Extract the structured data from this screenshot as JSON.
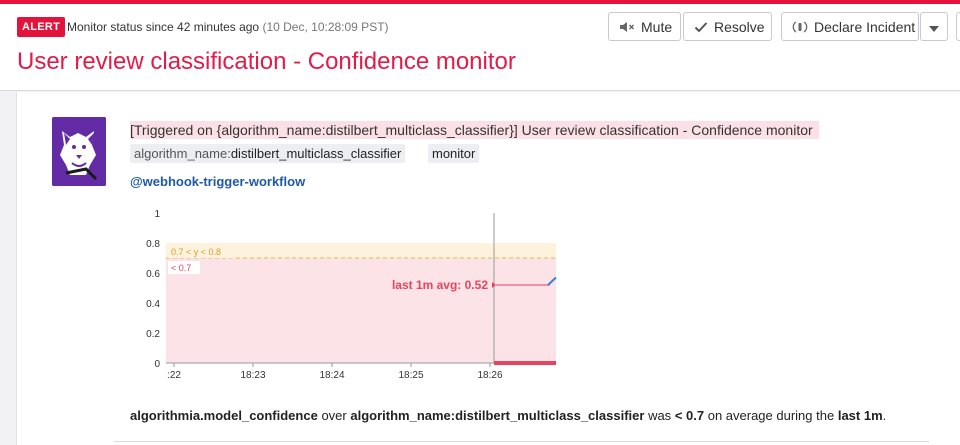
{
  "header": {
    "badge": "ALERT",
    "status_text": "Monitor status since 42 minutes ago",
    "status_timestamp": "(10 Dec, 10:28:09 PST)",
    "title": "User review classification - Confidence monitor"
  },
  "toolbar": {
    "mute_label": "Mute",
    "resolve_label": "Resolve",
    "declare_label": "Declare Incident"
  },
  "icons": [
    "mute-icon",
    "check-icon",
    "incident-icon",
    "caret-down-icon",
    "datadog-avatar-icon"
  ],
  "colors": {
    "alert_red": "#e31b49",
    "critical_zone": "#fbe3e7",
    "warning_zone": "#fdf3dc",
    "mention_blue": "#1f5aa6"
  },
  "event": {
    "message": "[Triggered on {algorithm_name:distilbert_multiclass_classifier}] User review classification - Confidence monitor",
    "tags": [
      {
        "key": "algorithm_name:",
        "value": "distilbert_multiclass_classifier"
      },
      {
        "key": "",
        "value": "monitor"
      }
    ],
    "mention": "@webhook-trigger-workflow"
  },
  "chart_data": {
    "type": "line",
    "y_ticks": [
      "1",
      "0.8",
      "0.6",
      "0.4",
      "0.2",
      "0"
    ],
    "ylim": [
      0,
      1
    ],
    "x_ticks": [
      ":22",
      "18:23",
      "18:24",
      "18:25",
      "18:26"
    ],
    "warning_label": "0.7 < y < 0.8",
    "critical_label": "< 0.7",
    "warning_range": [
      0.7,
      0.8
    ],
    "critical_threshold": 0.7,
    "annotation": "last 1m avg: 0.52",
    "last_avg": 0.52,
    "series": [
      {
        "values": [
          0.52,
          0.57
        ]
      }
    ]
  },
  "summary": {
    "metric": "algorithmia.model_confidence",
    "over": "over",
    "scope": "algorithm_name:distilbert_multiclass_classifier",
    "was": "was",
    "condition": "< 0.7",
    "on_avg": "on average during the",
    "window": "last 1m",
    "end": "."
  }
}
